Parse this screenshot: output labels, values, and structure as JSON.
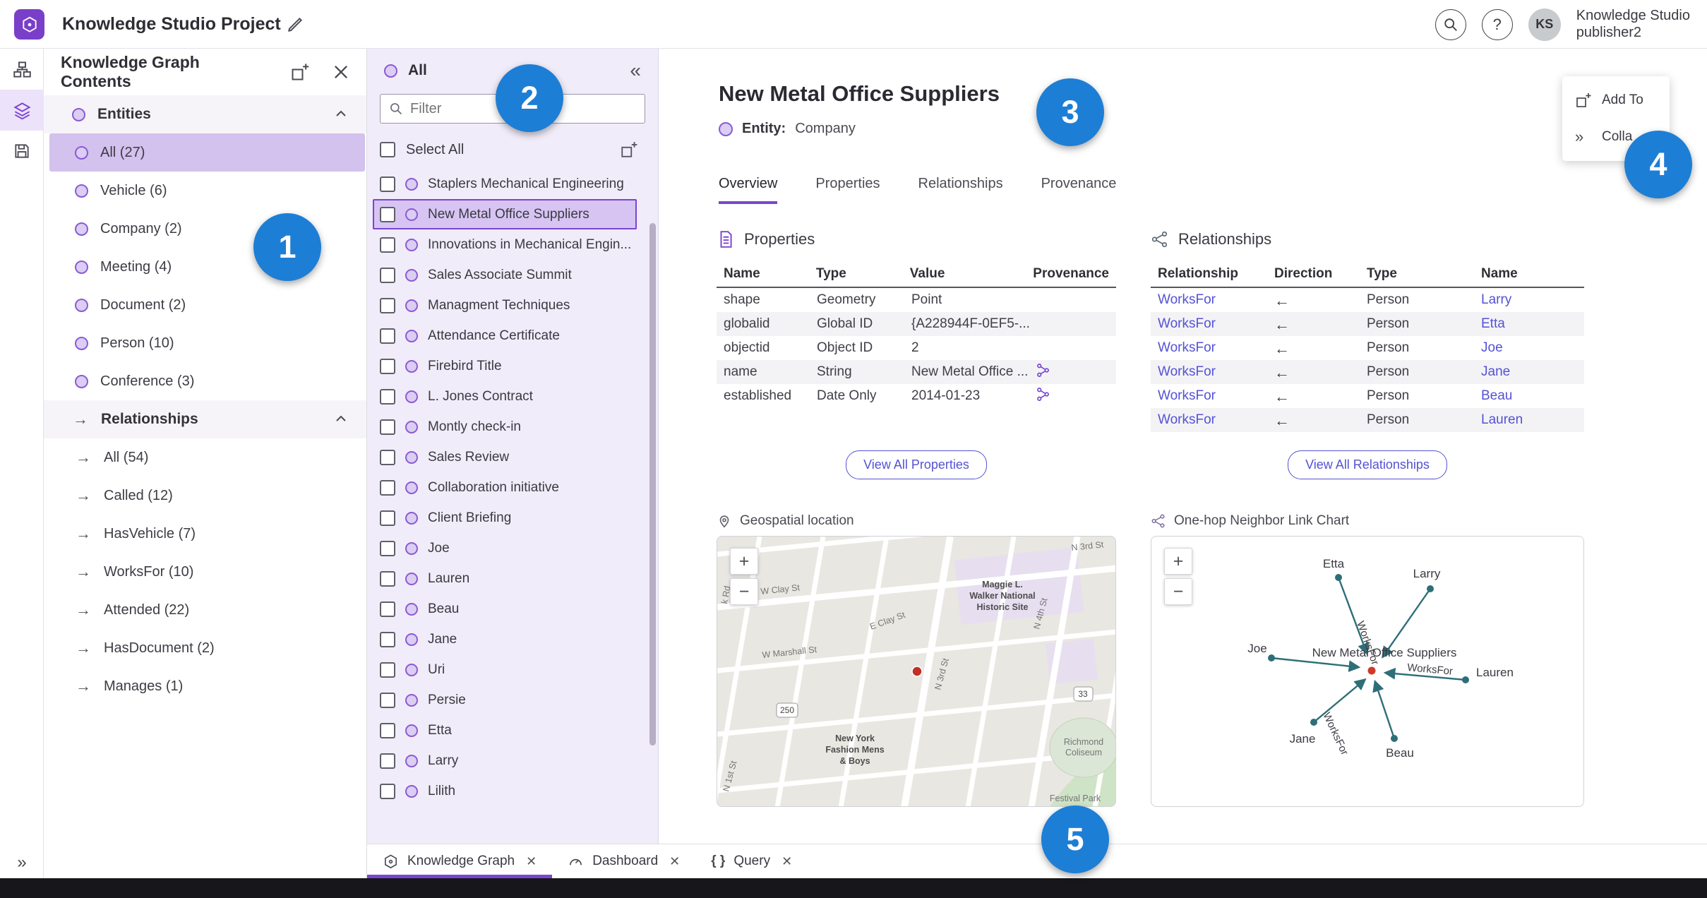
{
  "header": {
    "title": "Knowledge Studio Project",
    "help_glyph": "?",
    "avatar_initials": "KS",
    "user_name": "Knowledge Studio",
    "user_role": "publisher2"
  },
  "panel1": {
    "title": "Knowledge Graph Contents",
    "entities": {
      "label": "Entities",
      "items": [
        {
          "label": "All (27)",
          "selected": true
        },
        {
          "label": "Vehicle (6)"
        },
        {
          "label": "Company (2)"
        },
        {
          "label": "Meeting (4)"
        },
        {
          "label": "Document (2)"
        },
        {
          "label": "Person (10)"
        },
        {
          "label": "Conference (3)"
        }
      ]
    },
    "relationships": {
      "label": "Relationships",
      "items": [
        {
          "label": "All (54)"
        },
        {
          "label": "Called (12)"
        },
        {
          "label": "HasVehicle (7)"
        },
        {
          "label": "WorksFor (10)"
        },
        {
          "label": "Attended (22)"
        },
        {
          "label": "HasDocument (2)"
        },
        {
          "label": "Manages (1)"
        }
      ]
    }
  },
  "panel2": {
    "header": "All",
    "filter_placeholder": "Filter",
    "select_all_label": "Select All",
    "items": [
      {
        "label": "Staplers Mechanical Engineering"
      },
      {
        "label": "New Metal Office Suppliers",
        "selected": true
      },
      {
        "label": "Innovations in Mechanical Engin..."
      },
      {
        "label": "Sales Associate Summit"
      },
      {
        "label": "Managment Techniques"
      },
      {
        "label": "Attendance Certificate"
      },
      {
        "label": "Firebird Title"
      },
      {
        "label": "L. Jones Contract"
      },
      {
        "label": "Montly check-in"
      },
      {
        "label": "Sales Review"
      },
      {
        "label": "Collaboration initiative"
      },
      {
        "label": "Client Briefing"
      },
      {
        "label": "Joe"
      },
      {
        "label": "Lauren"
      },
      {
        "label": "Beau"
      },
      {
        "label": "Jane"
      },
      {
        "label": "Uri"
      },
      {
        "label": "Persie"
      },
      {
        "label": "Etta"
      },
      {
        "label": "Larry"
      },
      {
        "label": "Lilith"
      }
    ]
  },
  "main": {
    "title": "New Metal Office Suppliers",
    "entity_label": "Entity:",
    "entity_value": "Company",
    "tabs": [
      {
        "label": "Overview",
        "active": true
      },
      {
        "label": "Properties"
      },
      {
        "label": "Relationships"
      },
      {
        "label": "Provenance"
      }
    ],
    "properties": {
      "title": "Properties",
      "columns": [
        "Name",
        "Type",
        "Value",
        "Provenance"
      ],
      "rows": [
        {
          "name": "shape",
          "type": "Geometry",
          "value": "Point",
          "provenance": false
        },
        {
          "name": "globalid",
          "type": "Global ID",
          "value": "{A228944F-0EF5-...",
          "provenance": false
        },
        {
          "name": "objectid",
          "type": "Object ID",
          "value": "2",
          "provenance": false
        },
        {
          "name": "name",
          "type": "String",
          "value": "New Metal Office ...",
          "provenance": true
        },
        {
          "name": "established",
          "type": "Date Only",
          "value": "2014-01-23",
          "provenance": true
        }
      ],
      "view_all": "View All Properties"
    },
    "relationships": {
      "title": "Relationships",
      "columns": [
        "Relationship",
        "Direction",
        "Type",
        "Name"
      ],
      "rows": [
        {
          "relationship": "WorksFor",
          "direction": "←",
          "type": "Person",
          "name": "Larry"
        },
        {
          "relationship": "WorksFor",
          "direction": "←",
          "type": "Person",
          "name": "Etta"
        },
        {
          "relationship": "WorksFor",
          "direction": "←",
          "type": "Person",
          "name": "Joe"
        },
        {
          "relationship": "WorksFor",
          "direction": "←",
          "type": "Person",
          "name": "Jane"
        },
        {
          "relationship": "WorksFor",
          "direction": "←",
          "type": "Person",
          "name": "Beau"
        },
        {
          "relationship": "WorksFor",
          "direction": "←",
          "type": "Person",
          "name": "Lauren"
        }
      ],
      "view_all": "View All Relationships"
    },
    "geospatial": {
      "title": "Geospatial location",
      "zoom_in": "+",
      "zoom_out": "−",
      "map": {
        "streets": {
          "brook": "k Rd",
          "w_clay": "W Clay St",
          "e_clay": "E Clay St",
          "n_3rd_top": "N 3rd St",
          "n_3rd_mid": "N 3rd St",
          "n_4th": "N 4th St",
          "w_marshall": "W Marshall St",
          "n_1st": "N 1st St"
        },
        "shields": {
          "route_250": "250",
          "route_33": "33"
        },
        "pois": {
          "maggie_line1": "Maggie L.",
          "maggie_line2": "Walker National",
          "maggie_line3": "Historic Site",
          "fashion_line1": "New York",
          "fashion_line2": "Fashion Mens",
          "fashion_line3": "& Boys",
          "coliseum_line1": "Richmond",
          "coliseum_line2": "Coliseum",
          "park": "Festival Park"
        }
      }
    },
    "linkchart": {
      "title": "One-hop Neighbor Link Chart",
      "zoom_in": "+",
      "zoom_out": "−",
      "center_label": "New Metal Office Suppliers",
      "edge_label": "WorksFor",
      "nodes": {
        "etta": "Etta",
        "larry": "Larry",
        "joe": "Joe",
        "lauren": "Lauren",
        "jane": "Jane",
        "beau": "Beau"
      }
    }
  },
  "floating_menu": {
    "add_to": "Add To",
    "collapse": "Colla"
  },
  "bottom_tabs": {
    "items": [
      {
        "label": "Knowledge Graph",
        "active": true
      },
      {
        "label": "Dashboard"
      },
      {
        "label": "Query"
      }
    ],
    "query_braces": "{ }"
  },
  "badges": {
    "b1": "1",
    "b2": "2",
    "b3": "3",
    "b4": "4",
    "b5": "5"
  }
}
